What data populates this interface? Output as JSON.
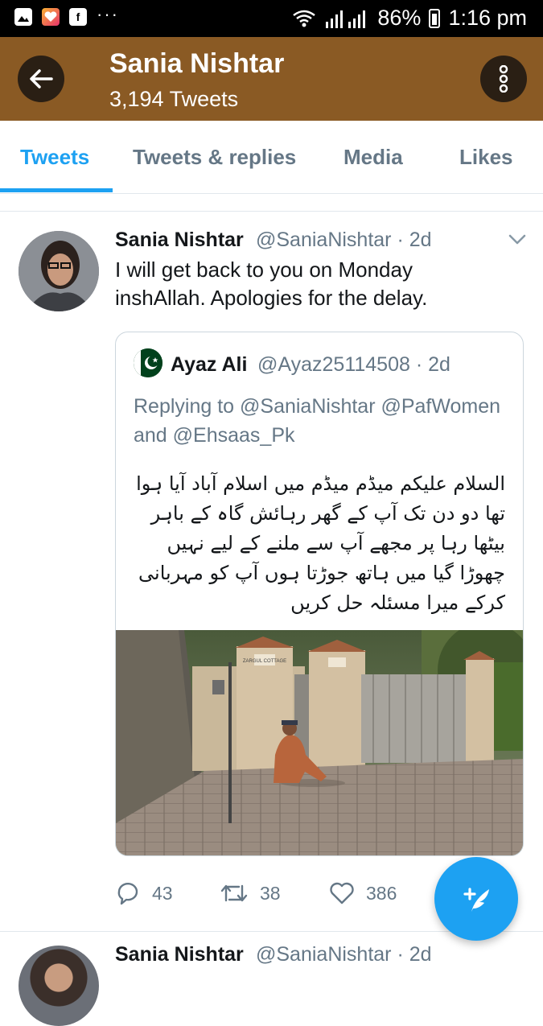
{
  "status_bar": {
    "battery": "86%",
    "time": "1:16 pm",
    "more": "···"
  },
  "header": {
    "title": "Sania Nishtar",
    "subtitle": "3,194 Tweets"
  },
  "tabs": [
    {
      "label": "Tweets",
      "active": true
    },
    {
      "label": "Tweets & replies",
      "active": false
    },
    {
      "label": "Media",
      "active": false
    },
    {
      "label": "Likes",
      "active": false
    }
  ],
  "tweet": {
    "name": "Sania Nishtar",
    "handle": "@SaniaNishtar · 2d",
    "text": "I will get back to you on Monday inshAllah. Apologies for the delay.",
    "quote": {
      "name": "Ayaz Ali",
      "handle": "@Ayaz25114508 · 2d",
      "replying": "Replying to @SaniaNishtar @PafWomen and @Ehsaas_Pk",
      "body": "السلام علیکم میڈم میڈم میں اسلام آباد آیا ہوا تھا دو دن تک آپ کے گھر رہائش گاہ کے باہر بیٹھا رہا پر مجھے آپ سے ملنے کے لیے نہیں چھوڑا گیا میں ہاتھ جوڑتا ہوں آپ کو مہربانی کرکے میرا مسئلہ حل کریں",
      "photo_signs": [
        "ZARGUL COTTAGE"
      ]
    },
    "actions": {
      "replies": "43",
      "retweets": "38",
      "likes": "386"
    }
  },
  "next_tweet": {
    "name": "Sania Nishtar",
    "handle": "@SaniaNishtar · 2d"
  },
  "colors": {
    "header_bg": "#8a5a24",
    "accent": "#1da1f2",
    "muted": "#657786"
  }
}
